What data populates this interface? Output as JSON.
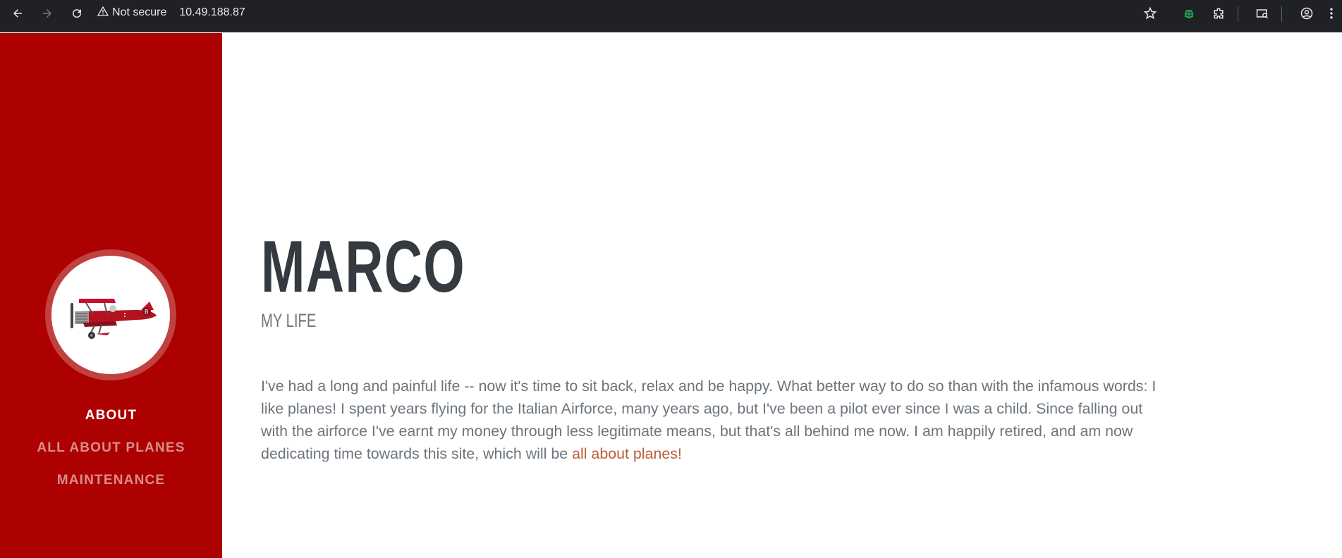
{
  "browser": {
    "security_label": "Not secure",
    "url": "10.49.188.87",
    "icons": [
      "back-icon",
      "forward-icon",
      "reload-icon",
      "warning-icon",
      "star-icon",
      "extension-bug-icon",
      "extensions-icon",
      "media-search-icon",
      "profile-icon",
      "menu-icon"
    ]
  },
  "sidebar": {
    "avatar_alt": "biplane",
    "nav": [
      {
        "label": "About",
        "active": true
      },
      {
        "label": "All About Planes",
        "active": false
      },
      {
        "label": "Maintenance",
        "active": false
      }
    ]
  },
  "main": {
    "title": "MARCO",
    "subtitle": "MY LIFE",
    "lead_text": "I've had a long and painful life -- now it's time to sit back, relax and be happy. What better way to do so than with the infamous words: I like planes! I spent years flying for the Italian Airforce, many years ago, but I've been a pilot ever since I was a child. Since falling out with the airforce I've earnt my money through less legitimate means, but that's all behind me now. I am happily retired, and am now dedicating time towards this site, which will be ",
    "lead_link": "all about planes!"
  },
  "colors": {
    "sidebar_bg": "#ad0000",
    "title": "#343a40",
    "body_text": "#6c757d",
    "link": "#bd5d38",
    "chrome_bg": "#202124"
  }
}
